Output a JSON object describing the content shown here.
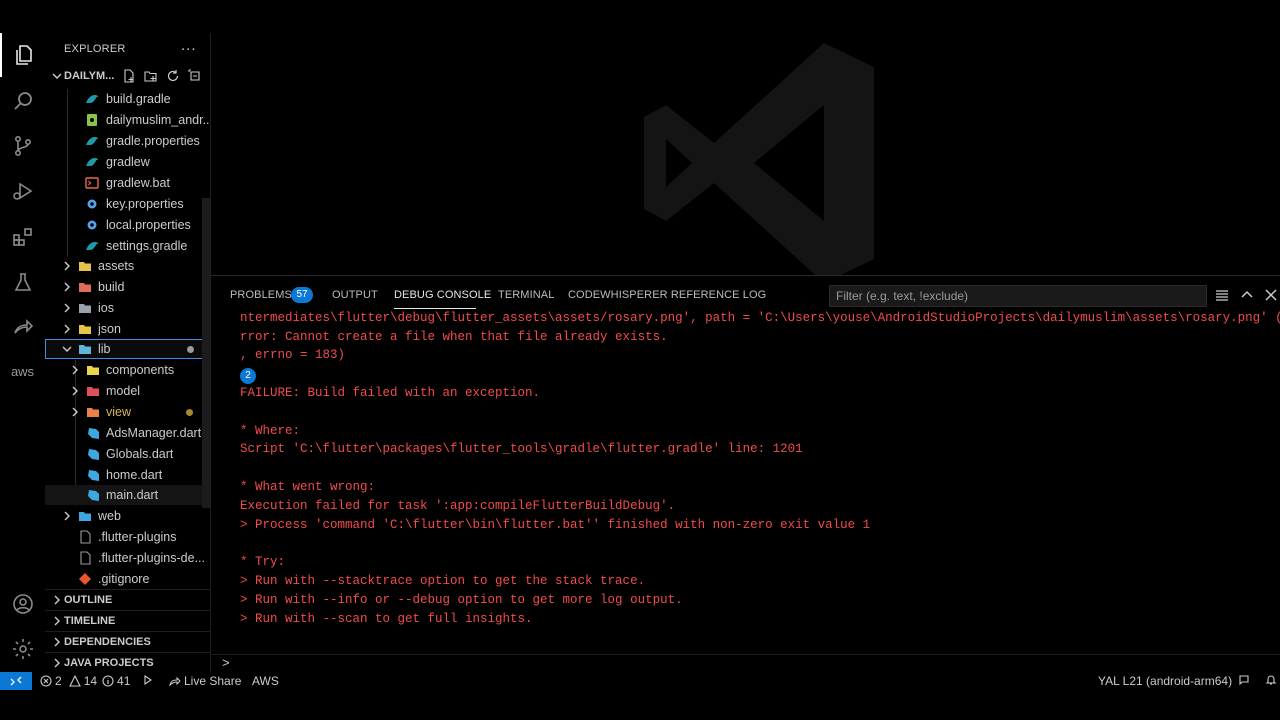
{
  "sidebar": {
    "title": "EXPLORER",
    "more": "...",
    "project": "DAILYM...",
    "files": [
      {
        "label": "build.gradle",
        "icon": "gradle-icon"
      },
      {
        "label": "dailymuslim_andr...",
        "icon": "android-file-icon"
      },
      {
        "label": "gradle.properties",
        "icon": "gradle-icon"
      },
      {
        "label": "gradlew",
        "icon": "gradle-icon"
      },
      {
        "label": "gradlew.bat",
        "icon": "batch-file-icon"
      },
      {
        "label": "key.properties",
        "icon": "gear-icon"
      },
      {
        "label": "local.properties",
        "icon": "gear-icon"
      },
      {
        "label": "settings.gradle",
        "icon": "gradle-icon"
      }
    ],
    "folders": [
      {
        "label": "assets"
      },
      {
        "label": "build"
      },
      {
        "label": "ios"
      },
      {
        "label": "json"
      },
      {
        "label": "lib"
      }
    ],
    "lib_children": [
      {
        "label": "components"
      },
      {
        "label": "model"
      },
      {
        "label": "view"
      }
    ],
    "dart_files": [
      {
        "label": "AdsManager.dart"
      },
      {
        "label": "Globals.dart"
      },
      {
        "label": "home.dart"
      },
      {
        "label": "main.dart"
      }
    ],
    "after": [
      {
        "label": "web"
      },
      {
        "label": ".flutter-plugins"
      },
      {
        "label": ".flutter-plugins-de..."
      },
      {
        "label": ".gitignore"
      }
    ],
    "sections": [
      {
        "label": "OUTLINE"
      },
      {
        "label": "TIMELINE"
      },
      {
        "label": "DEPENDENCIES"
      },
      {
        "label": "JAVA PROJECTS"
      }
    ]
  },
  "activity": {
    "aws": "aws"
  },
  "panel": {
    "tabs": [
      {
        "label": "PROBLEMS"
      },
      {
        "label": "OUTPUT"
      },
      {
        "label": "DEBUG CONSOLE"
      },
      {
        "label": "TERMINAL"
      },
      {
        "label": "CODEWHISPERER REFERENCE LOG"
      }
    ],
    "problems_count": "57",
    "filter_placeholder": "Filter (e.g. text, !exclude)",
    "console_lines": [
      "ntermediates\\flutter\\debug\\flutter_assets\\assets/rosary.png', path = 'C:\\Users\\youse\\AndroidStudioProjects\\dailymuslim\\assets\\rosary.png' (OS E",
      "rror: Cannot create a file when that file already exists.",
      ", errno = 183)",
      "FAILURE: Build failed with an exception.",
      "* Where:",
      "Script 'C:\\flutter\\packages\\flutter_tools\\gradle\\flutter.gradle' line: 1201",
      "* What went wrong:",
      "Execution failed for task ':app:compileFlutterBuildDebug'.",
      "> Process 'command 'C:\\flutter\\bin\\flutter.bat'' finished with non-zero exit value 1",
      "* Try:",
      "> Run with --stacktrace option to get the stack trace.",
      "> Run with --info or --debug option to get more log output.",
      "> Run with --scan to get full insights."
    ],
    "repeat_count": "2",
    "prompt": ">"
  },
  "status": {
    "errors": "2",
    "warnings": "14",
    "infos": "41",
    "live_share": "Live Share",
    "aws": "AWS",
    "device": "YAL L21 (android-arm64)"
  },
  "colors": {
    "accent": "#0a78d4",
    "error_text": "#f14c4c"
  }
}
